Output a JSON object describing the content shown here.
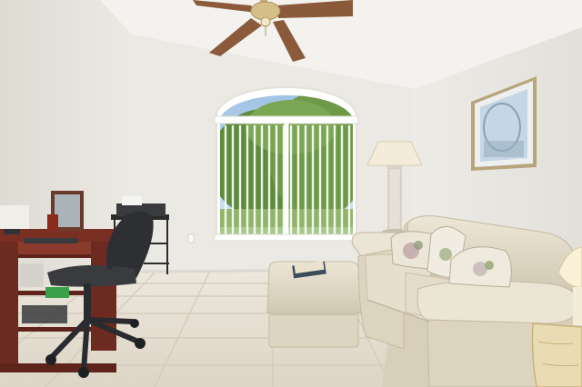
{
  "image": {
    "kind": "photograph",
    "scene": "living-room-home-office",
    "colors": {
      "wall": "#e8e6e0",
      "ceiling": "#f2f1ec",
      "floor_tile": "#e6e0d4",
      "grout": "#cfc8ba",
      "window_frame": "#ffffff",
      "tree_green": "#6e9a48",
      "sky": "#a8c8e6",
      "leather": "#e3dccb",
      "leather_shadow": "#c9c0aa",
      "desk_wood": "#7a2f23",
      "chair_black": "#2e2f33",
      "fan_blade": "#8b5a3a",
      "lamp_shade": "#f4ecd8"
    },
    "icons": [
      "ceiling-fan",
      "arched-window",
      "floor-lamp",
      "framed-art",
      "sofa",
      "ottoman",
      "office-chair",
      "desk",
      "side-table"
    ]
  }
}
